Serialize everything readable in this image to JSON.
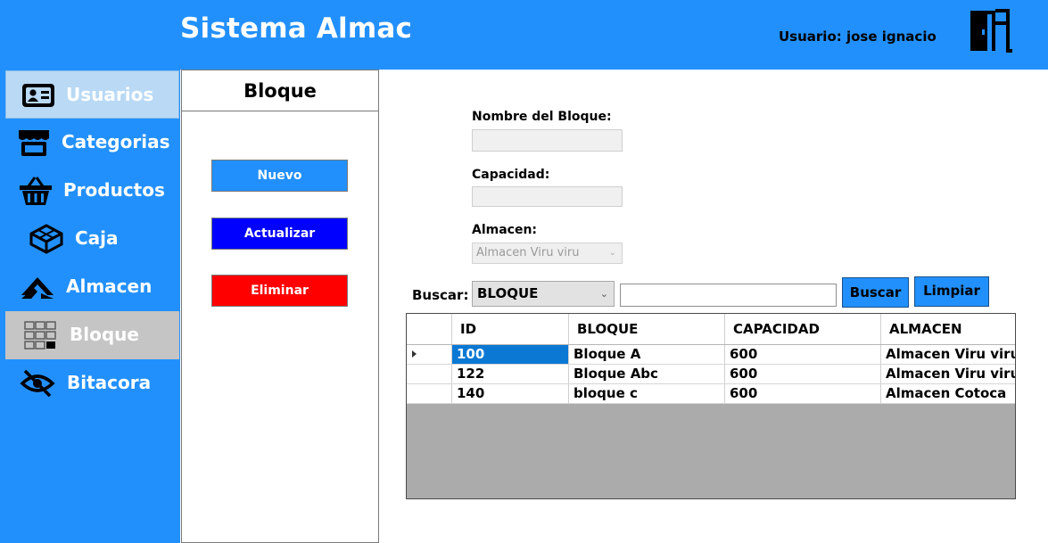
{
  "header": {
    "title": "Sistema Almac",
    "user_text": "Usuario: jose ignacio",
    "logout_icon": "exit-door-icon",
    "color": "#2290fc"
  },
  "sidebar": {
    "items": [
      {
        "label": "Usuarios",
        "icon": "id-card-icon",
        "state": "hover"
      },
      {
        "label": "Categorias",
        "icon": "store-icon"
      },
      {
        "label": "Productos",
        "icon": "basket-icon"
      },
      {
        "label": "Caja",
        "icon": "cube-icon"
      },
      {
        "label": "Almacen",
        "icon": "warehouse-icon"
      },
      {
        "label": "Bloque",
        "icon": "grid-blocks-icon",
        "state": "selected"
      },
      {
        "label": "Bitacora",
        "icon": "eye-slash-icon"
      }
    ]
  },
  "panel": {
    "title": "Bloque",
    "buttons": [
      {
        "label": "Nuevo",
        "color": "#2290fc"
      },
      {
        "label": "Actualizar",
        "color": "#0000ff"
      },
      {
        "label": "Eliminar",
        "color": "#ff0000"
      }
    ]
  },
  "form": {
    "nombre_label": "Nombre del Bloque:",
    "nombre_value": "",
    "capacidad_label": "Capacidad:",
    "capacidad_value": "",
    "almacen_label": "Almacen:",
    "almacen_value": "Almacen Viru viru"
  },
  "search": {
    "label": "Buscar:",
    "field_value": "BLOQUE",
    "query": "",
    "buscar_button": "Buscar",
    "limpiar_button": "Limpiar"
  },
  "grid": {
    "columns": [
      "ID",
      "BLOQUE",
      "CAPACIDAD",
      "ALMACEN"
    ],
    "rows": [
      {
        "id": "100",
        "bloque": "Bloque A",
        "capacidad": "600",
        "almacen": "Almacen Viru viru"
      },
      {
        "id": "122",
        "bloque": "Bloque Abc",
        "capacidad": "600",
        "almacen": "Almacen Viru viru"
      },
      {
        "id": "140",
        "bloque": "bloque c",
        "capacidad": "600",
        "almacen": "Almacen Cotoca"
      }
    ],
    "selected_row": 0
  }
}
